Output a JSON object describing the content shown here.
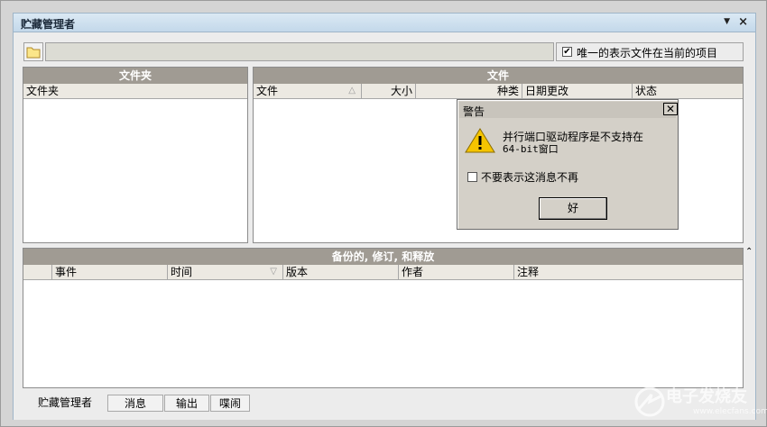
{
  "window": {
    "title": "贮藏管理者"
  },
  "toolbar": {
    "unique_checked": "✔",
    "unique_label": "唯一的表示文件在当前的项目"
  },
  "folders_panel": {
    "title": "文件夹",
    "column": "文件夹"
  },
  "files_panel": {
    "title": "文件",
    "columns": [
      "文件",
      "大小",
      "种类",
      "日期更改",
      "状态"
    ]
  },
  "revisions_panel": {
    "title": "备份的, 修订, 和释放",
    "columns": [
      "事件",
      "时间",
      "版本",
      "作者",
      "注释"
    ]
  },
  "dialog": {
    "title": "警告",
    "message_line1": "并行端口驱动程序是不支持在",
    "message_line2": "64-bit窗口",
    "dont_show_label": "不要表示这消息不再",
    "ok_label": "好"
  },
  "tabs": [
    "贮藏管理者",
    "消息",
    "输出",
    "喋闹"
  ],
  "watermark": {
    "text": "电子发烧友",
    "url": "www.elecfans.com"
  }
}
